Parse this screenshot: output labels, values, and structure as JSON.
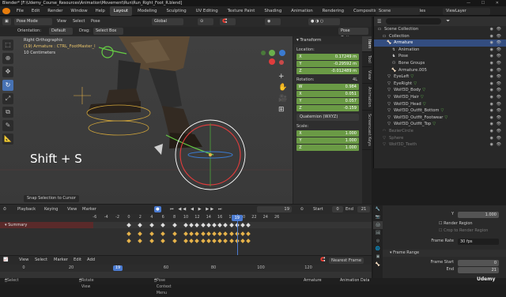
{
  "window": {
    "title": "Blender* [F:\\Udemy_Course_Resources\\Animation\\Movement\\Run\\Run_Right_Foot_R.blend]"
  },
  "menubar": {
    "menus": [
      "File",
      "Edit",
      "Render",
      "Window",
      "Help"
    ],
    "workspaces": [
      "Layout",
      "Modeling",
      "Sculpting",
      "UV Editing",
      "Texture Paint",
      "Shading",
      "Animation",
      "Rendering",
      "Compositing",
      "Geometry Nodes"
    ],
    "active_workspace": "Layout",
    "scene": "Scene",
    "view_layer": "ViewLayer"
  },
  "viewport_header": {
    "mode": "Pose Mode",
    "view": "View",
    "select": "Select",
    "pose": "Pose",
    "orientation_space": "Global",
    "orientation_label": "Orientation:",
    "orientation_value": "Default",
    "drag_label": "Drag:",
    "drag_value": "Select Box",
    "options": "Pose Options"
  },
  "viewport": {
    "view_name": "Right Orthographic",
    "armature_line": "(19) Armature : CTRL_FootMaster_l",
    "scale_line": "10 Centimeters",
    "overlay_text": "Shift + S",
    "status_popup": "Snap Selection to Cursor"
  },
  "tools": [
    "select-box",
    "cursor",
    "move",
    "rotate",
    "scale",
    "transform",
    "annotate",
    "measure",
    "relax"
  ],
  "transform_panel": {
    "header": "Transform",
    "location_label": "Location:",
    "location": [
      {
        "axis": "X",
        "value": "0.17249 m"
      },
      {
        "axis": "Y",
        "value": "-0.29592 m"
      },
      {
        "axis": "Z",
        "value": "-0.012489 m"
      }
    ],
    "rotation_label": "Rotation:",
    "rotation_mode_tag": "4L",
    "rotation": [
      {
        "axis": "W",
        "value": "0.984"
      },
      {
        "axis": "X",
        "value": "0.051"
      },
      {
        "axis": "Y",
        "value": "0.057"
      },
      {
        "axis": "Z",
        "value": "-0.159"
      }
    ],
    "rotation_mode": "Quaternion (WXYZ)",
    "scale_label": "Scale:",
    "scale": [
      {
        "axis": "X",
        "value": "1.000"
      },
      {
        "axis": "Y",
        "value": "1.000"
      },
      {
        "axis": "Z",
        "value": "1.000"
      }
    ]
  },
  "npanel_tabs": [
    "Item",
    "Tool",
    "View",
    "Animation",
    "Screencast Keys"
  ],
  "outliner": {
    "search_placeholder": "",
    "rows": [
      {
        "label": "Scene Collection",
        "indent": 0,
        "icon": "collection",
        "selected": false,
        "dim": false
      },
      {
        "label": "Collection",
        "indent": 1,
        "icon": "collection",
        "selected": false,
        "dim": false
      },
      {
        "label": "Armature",
        "indent": 2,
        "icon": "armature",
        "selected": true,
        "dim": false
      },
      {
        "label": "Animation",
        "indent": 3,
        "icon": "animation",
        "selected": false,
        "dim": false
      },
      {
        "label": "Pose",
        "indent": 3,
        "icon": "pose",
        "selected": false,
        "dim": false
      },
      {
        "label": "Bone Groups",
        "indent": 3,
        "icon": "bones",
        "selected": false,
        "dim": false
      },
      {
        "label": "Armature.005",
        "indent": 3,
        "icon": "armature",
        "selected": false,
        "dim": false
      },
      {
        "label": "EyeLeft",
        "indent": 2,
        "icon": "mesh",
        "selected": false,
        "dim": false
      },
      {
        "label": "EyeRight",
        "indent": 2,
        "icon": "mesh",
        "selected": false,
        "dim": false
      },
      {
        "label": "Wolf3D_Body",
        "indent": 2,
        "icon": "mesh",
        "selected": false,
        "dim": false
      },
      {
        "label": "Wolf3D_Hair",
        "indent": 2,
        "icon": "mesh",
        "selected": false,
        "dim": false
      },
      {
        "label": "Wolf3D_Head",
        "indent": 2,
        "icon": "mesh",
        "selected": false,
        "dim": false
      },
      {
        "label": "Wolf3D_Outfit_Bottom",
        "indent": 2,
        "icon": "mesh",
        "selected": false,
        "dim": false
      },
      {
        "label": "Wolf3D_Outfit_Footwear",
        "indent": 2,
        "icon": "mesh",
        "selected": false,
        "dim": false
      },
      {
        "label": "Wolf3D_Outfit_Top",
        "indent": 2,
        "icon": "mesh",
        "selected": false,
        "dim": false
      },
      {
        "label": "BezierCircle",
        "indent": 1,
        "icon": "curve",
        "selected": false,
        "dim": true
      },
      {
        "label": "Sphere",
        "indent": 1,
        "icon": "mesh",
        "selected": false,
        "dim": true
      },
      {
        "label": "Wolf3D_Teeth",
        "indent": 1,
        "icon": "mesh",
        "selected": false,
        "dim": true
      }
    ]
  },
  "properties": {
    "y_label": "Y",
    "y_value": "1.000",
    "render_region": "Render Region",
    "crop_region": "Crop to Render Region",
    "frame_rate_label": "Frame Rate",
    "frame_rate_value": "30 fps",
    "frame_range_header": "Frame Range",
    "frame_start_label": "Frame Start",
    "frame_start_value": "0",
    "frame_end_label": "End",
    "frame_end_value": "21"
  },
  "timeline": {
    "menus": [
      "Playback",
      "Keying",
      "View",
      "Marker"
    ],
    "current_frame": "19",
    "start_label": "Start",
    "start_value": "0",
    "end_label": "End",
    "end_value": "21",
    "ruler": [
      "-6",
      "-4",
      "-2",
      "0",
      "2",
      "4",
      "6",
      "8",
      "10",
      "12",
      "14",
      "16",
      "18",
      "20",
      "22",
      "24",
      "26"
    ],
    "summary_label": "Summary",
    "keyframe_frames": [
      0,
      2,
      4,
      6,
      8,
      10,
      11,
      12,
      13,
      14,
      15,
      16,
      17,
      18,
      19,
      20,
      21
    ]
  },
  "graph_editor": {
    "menus": [
      "View",
      "Select",
      "Marker",
      "Edit",
      "Add"
    ],
    "snap": "Nearest Frame",
    "ruler": [
      "0",
      "20",
      "40",
      "60",
      "80",
      "100",
      "120"
    ],
    "current_frame": "19"
  },
  "statusbar": {
    "left": "Select",
    "middle": "Rotate View",
    "right": "Pose Context Menu",
    "object": "Armature",
    "data": "Animation Data"
  },
  "watermark": "Udemy",
  "colors": {
    "accent": "#4772b3",
    "field_green": "#6a9a45",
    "selection": "#334d80",
    "keyframe": "#e6b34a"
  }
}
